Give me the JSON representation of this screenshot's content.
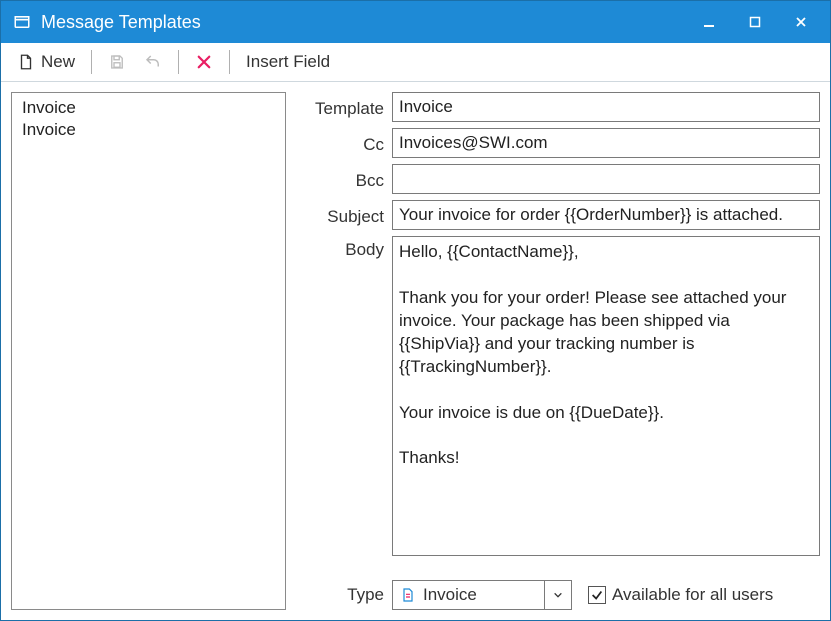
{
  "window": {
    "title": "Message Templates"
  },
  "toolbar": {
    "new_label": "New",
    "insert_field_label": "Insert Field"
  },
  "template_list": {
    "items": [
      "Invoice",
      "Invoice"
    ]
  },
  "form": {
    "labels": {
      "template": "Template",
      "cc": "Cc",
      "bcc": "Bcc",
      "subject": "Subject",
      "body": "Body",
      "type": "Type"
    },
    "values": {
      "template": "Invoice",
      "cc": "Invoices@SWI.com",
      "bcc": "",
      "subject": "Your invoice for order {{OrderNumber}} is attached.",
      "body": "Hello, {{ContactName}},\n\nThank you for your order! Please see attached your invoice. Your package has been shipped via {{ShipVia}} and your tracking number is {{TrackingNumber}}.\n\nYour invoice is due on {{DueDate}}.\n\nThanks!"
    },
    "type": {
      "selected": "Invoice"
    },
    "available_all_users": {
      "label": "Available for all users",
      "checked": true
    }
  }
}
